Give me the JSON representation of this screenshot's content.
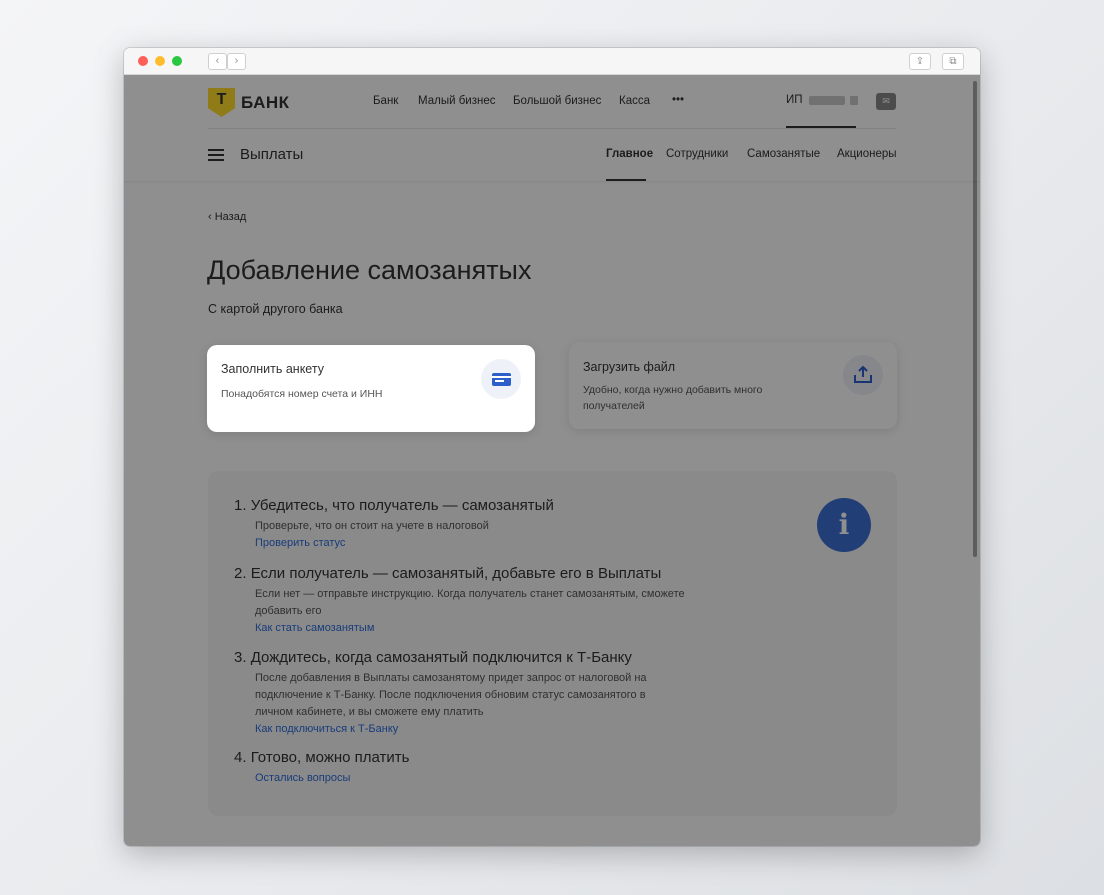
{
  "header": {
    "logo_mark": "Т",
    "logo_text": "БАНК",
    "nav": [
      "Банк",
      "Малый бизнес",
      "Большой бизнес",
      "Касса",
      "•••"
    ],
    "account_prefix": "ИП",
    "section_title": "Выплаты",
    "subnav": [
      "Главное",
      "Сотрудники",
      "Самозанятые",
      "Акционеры"
    ]
  },
  "page": {
    "back": "Назад",
    "title": "Добавление самозанятых",
    "subtitle": "С картой другого банка"
  },
  "options": [
    {
      "title": "Заполнить анкету",
      "desc": "Понадобятся номер счета и ИНН",
      "icon": "card-icon"
    },
    {
      "title": "Загрузить файл",
      "desc": "Удобно, когда нужно добавить много получателей",
      "icon": "upload-icon"
    }
  ],
  "steps": [
    {
      "num": "1.",
      "title": "Убедитесь, что получатель — самозанятый",
      "desc": "Проверьте, что он стоит на учете в налоговой",
      "link": "Проверить статус"
    },
    {
      "num": "2.",
      "title": "Если получатель — самозанятый, добавьте его в Выплаты",
      "desc": "Если нет — отправьте инструкцию. Когда получатель станет самозанятым, сможете добавить его",
      "link": "Как стать самозанятым"
    },
    {
      "num": "3.",
      "title": "Дождитесь, когда самозанятый подключится к Т-Банку",
      "desc": "После добавления в Выплаты самозанятому придет запрос от налоговой на подключение к Т-Банку. После подключения обновим статус самозанятого в личном кабинете, и вы сможете ему платить",
      "link": "Как подключиться к Т-Банку"
    },
    {
      "num": "4.",
      "title": "Готово, можно платить",
      "desc": "",
      "link": "Остались вопросы"
    }
  ],
  "info_icon": "i",
  "colors": {
    "brand": "#ffdd2d",
    "link": "#2d6bd8",
    "info": "#3b6fd4",
    "overlay": "rgba(0,0,0,0.44)"
  }
}
